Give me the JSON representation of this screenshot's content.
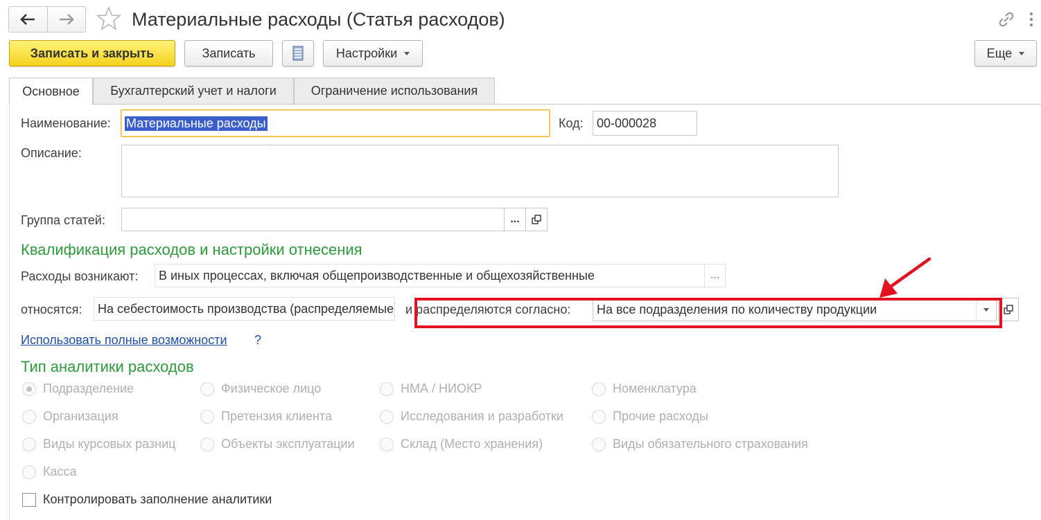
{
  "window": {
    "title": "Материальные расходы (Статья расходов)",
    "nav_back_icon": "arrow-left-icon",
    "nav_forward_icon": "arrow-right-icon",
    "favorite_icon": "star-icon",
    "link_icon": "link-icon",
    "more_icon": "vertical-dots-icon"
  },
  "toolbar": {
    "save_close_label": "Записать и закрыть",
    "save_label": "Записать",
    "report_icon": "document-list-icon",
    "settings_label": "Настройки",
    "more_label": "Еще"
  },
  "tabs": [
    {
      "label": "Основное",
      "active": true
    },
    {
      "label": "Бухгалтерский учет и налоги",
      "active": false
    },
    {
      "label": "Ограничение использования",
      "active": false
    }
  ],
  "form": {
    "name_label": "Наименование:",
    "name_value": "Материальные расходы",
    "code_label": "Код:",
    "code_value": "00-000028",
    "description_label": "Описание:",
    "description_value": "",
    "group_label": "Группа статей:",
    "group_value": "",
    "select_button_label": "..."
  },
  "qualification": {
    "section_title": "Квалификация расходов и настройки отнесения",
    "arise_label": "Расходы возникают:",
    "arise_value": "В иных процессах, включая общепроизводственные и общехозяйственные",
    "relate_label": "относятся:",
    "relate_value": "На себестоимость производства (распределяемые)",
    "distribute_label": "и распределяются согласно:",
    "distribute_value": "На все подразделения по количеству продукции",
    "full_features_link": "Использовать полные возможности",
    "help_label": "?"
  },
  "analytics": {
    "section_title": "Тип аналитики расходов",
    "options": [
      [
        "Подразделение",
        "Физическое лицо",
        "НМА / НИОКР",
        "Номенклатура"
      ],
      [
        "Организация",
        "Претензия клиента",
        "Исследования и разработки",
        "Прочие расходы"
      ],
      [
        "Виды курсовых разниц",
        "Объекты эксплуатации",
        "Склад (Место хранения)",
        "Виды обязательного страхования"
      ],
      [
        "Касса"
      ]
    ],
    "selected": "Подразделение",
    "control_checkbox_label": "Контролировать заполнение аналитики",
    "control_checked": false
  },
  "annotation": {
    "highlight_color": "#e0131f"
  }
}
